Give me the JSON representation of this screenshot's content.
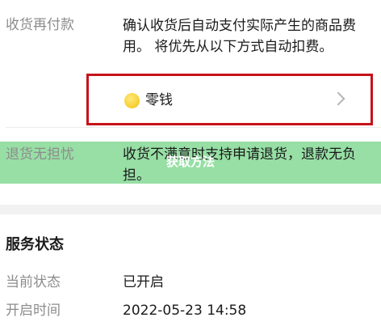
{
  "pay_after_receipt": {
    "label": "收货再付款",
    "description": "确认收货后自动支付实际产生的商品费用。 将优先从以下方式自动扣费。"
  },
  "payment_method": {
    "icon": "coin-icon",
    "label": "零钱"
  },
  "return_guarantee": {
    "label": "退货无担忧",
    "description": "收货不满意时支持申请退货，退款无负担。"
  },
  "overlay_banner": {
    "text": "获取方法",
    "color": "#7ad68c"
  },
  "service_status": {
    "title": "服务状态",
    "current_status_label": "当前状态",
    "current_status_value": "已开启",
    "enabled_time_label": "开启时间",
    "enabled_time_value": "2022-05-23 14:58"
  },
  "colors": {
    "highlight_border": "#c7121b",
    "label_gray": "#8c8c8c"
  }
}
